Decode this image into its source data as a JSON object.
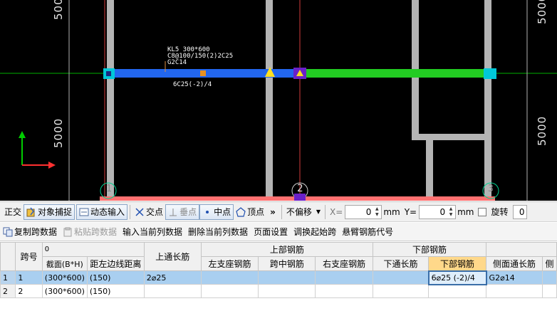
{
  "canvas": {
    "dims_left": [
      "5000",
      "5000"
    ],
    "dims_right": [
      "5000",
      "5000"
    ],
    "beam_label": [
      "KL5 300*600",
      "C8@100/150(2)2C25",
      "G2C14"
    ],
    "beam_bottom_label": "6C25(-2)/4",
    "axis_numbers": [
      "1",
      "2",
      "3"
    ],
    "colors": {
      "background": "#000000",
      "column": "#b4b4b4",
      "beam_blue": "#2266ee",
      "beam_green": "#22cc22",
      "axis_red": "#ff4040",
      "axis_green": "#00cc00",
      "grid_line": "#c83a3a",
      "cyan_marker": "#00c8d8"
    }
  },
  "snapbar": {
    "ortho": "正交",
    "object_snap": "对象捕捉",
    "dynamic_input": "动态输入",
    "intersection": "交点",
    "perpendicular": "垂点",
    "midpoint": "中点",
    "vertex": "顶点",
    "more": "»",
    "offset_mode": "不偏移",
    "x_label": "X=",
    "x_value": "0",
    "unit_mm1": "mm",
    "y_label": "Y=",
    "y_value": "0",
    "unit_mm2": "mm",
    "rotate": "旋转",
    "rotate_value": "0"
  },
  "toolbar2": {
    "copy_span": "复制跨数据",
    "paste_span": "粘贴跨数据",
    "input_current": "输入当前列数据",
    "delete_current": "删除当前列数据",
    "page_settings": "页面设置",
    "swap_start": "调换起始跨",
    "cantilever": "悬臂钢筋代号"
  },
  "grid": {
    "header_top": {
      "span_no": "跨号",
      "corner": "0",
      "top_through": "上通长筋",
      "top_rebar": "上部钢筋",
      "bottom_rebar": "下部钢筋"
    },
    "header_sub": {
      "section": "截面(B*H)",
      "edge_dist": "距左边线距离",
      "left_support": "左支座钢筋",
      "mid_span": "跨中钢筋",
      "right_support": "右支座钢筋",
      "bottom_through": "下通长筋",
      "bottom_rebar": "下部钢筋",
      "side_through": "侧面通长筋",
      "more": "侧"
    },
    "rows": [
      {
        "row": "1",
        "span": "1",
        "section": "(300*600)",
        "edge": "(150)",
        "top_through": "2⌀25",
        "left": "",
        "mid": "",
        "right": "",
        "bottom_through": "",
        "bottom": "6⌀25 (-2)/4",
        "side": "G2⌀14"
      },
      {
        "row": "2",
        "span": "2",
        "section": "(300*600)",
        "edge": "(150)",
        "top_through": "",
        "left": "",
        "mid": "",
        "right": "",
        "bottom_through": "",
        "bottom": "",
        "side": ""
      }
    ]
  }
}
